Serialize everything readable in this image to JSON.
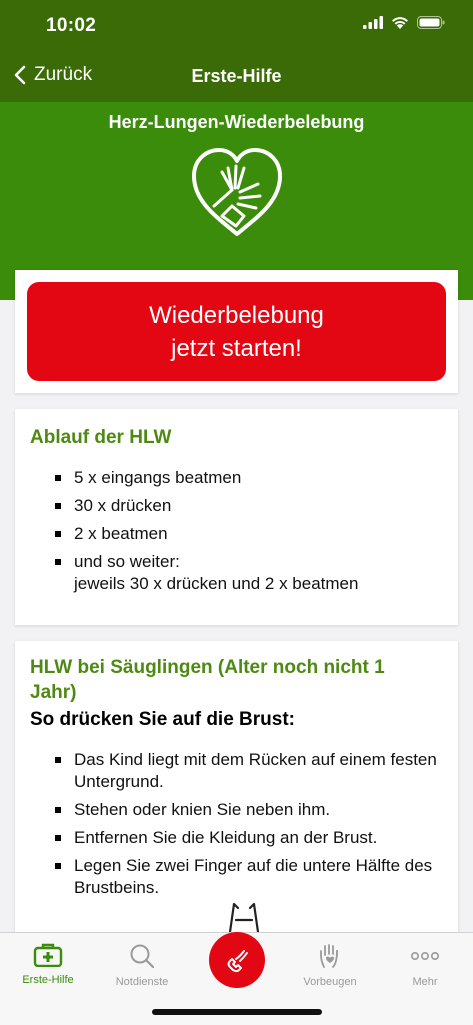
{
  "status": {
    "time": "10:02"
  },
  "nav": {
    "back_label": "Zurück",
    "title": "Erste-Hilfe"
  },
  "hero": {
    "title": "Herz-Lungen-Wiederbelebung"
  },
  "cta": {
    "line1": "Wiederbelebung",
    "line2": "jetzt starten!"
  },
  "hlw": {
    "title": "Ablauf der HLW",
    "items": [
      "5 x eingangs beatmen",
      "30 x drücken",
      "2 x beatmen"
    ],
    "last_line1": "und so weiter:",
    "last_line2": "jeweils 30 x drücken und 2 x beatmen"
  },
  "infants": {
    "title": "HLW bei Säuglingen (Alter noch nicht 1 Jahr)",
    "subtitle": "So drücken Sie auf die Brust:",
    "items": [
      "Das Kind liegt mit dem Rücken auf einem festen Untergrund.",
      "Stehen oder knien Sie neben ihm.",
      "Entfernen Sie die Kleidung an der Brust.",
      "Legen Sie zwei Finger auf die untere Hälfte des Brustbeins."
    ]
  },
  "tabbar": {
    "tab1": "Erste-Hilfe",
    "tab2": "Notdienste",
    "tab4": "Vorbeugen",
    "tab5": "Mehr"
  },
  "colors": {
    "nav_green": "#3a6b07",
    "hero_green": "#3a8c0a",
    "title_green": "#4e8a13",
    "red": "#e30613"
  }
}
